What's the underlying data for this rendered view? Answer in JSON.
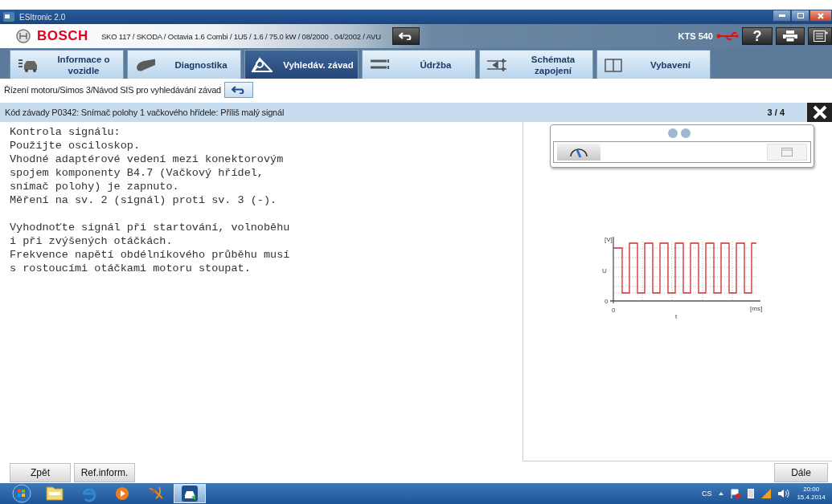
{
  "window": {
    "title": "ESItronic 2.0"
  },
  "header": {
    "brand": "BOSCH",
    "vehicle": "SKO 117 / SKODA / Octavia 1.6 Combi / 1U5 / 1.6 / 75.0 kW / 08/2000 . 04/2002 / AVU",
    "device": "KTS 540",
    "help": "?"
  },
  "tabs": [
    {
      "label": "Informace o vozidle",
      "selected": false
    },
    {
      "label": "Diagnostika",
      "selected": false
    },
    {
      "label": "Vyhledáv. závad",
      "selected": true
    },
    {
      "label": "Údržba",
      "selected": false
    },
    {
      "label": "Schémata zapojení",
      "selected": false
    },
    {
      "label": "Vybavení",
      "selected": false
    }
  ],
  "breadcrumb": "Řízení motoru/Simos 3/Návod SIS pro vyhledávání závad",
  "fault": {
    "title": "Kód závady P0342: Snímač polohy 1 vačkového hřídele: Příliš malý signál",
    "page": "3 / 4"
  },
  "instructions": [
    [
      "Kontrola signálu:",
      "Použijte osciloskop.",
      "Vhodné adaptérové vedení mezi konektorovým",
      "spojem komponenty B4.7 (Vačkový hřídel,",
      "snímač polohy) je zapnuto.",
      "Měření na sv. 2 (signál) proti sv. 3 (-)."
    ],
    [
      "Vyhodnoťte signál při startování, volnoběhu",
      "i při zvýšených otáčkách.",
      "Frekvence napětí obdélníkového průběhu musí",
      "s rostoucími otáčkami motoru stoupat."
    ]
  ],
  "waveform": {
    "y_unit": "[V]",
    "y_label": "U",
    "y_origin": "0",
    "x_origin": "0",
    "x_label": "t",
    "x_unit": "[ms]"
  },
  "footer": {
    "left_buttons": [
      "Zpět",
      "Ref.inform."
    ],
    "right_buttons": [
      "Dále"
    ]
  },
  "taskbar": {
    "apps": [
      {
        "selected": false
      },
      {
        "selected": false
      },
      {
        "selected": false
      },
      {
        "selected": false
      },
      {
        "selected": true
      }
    ],
    "language": "CS",
    "time": "20:00",
    "date": "15.4.2014"
  }
}
